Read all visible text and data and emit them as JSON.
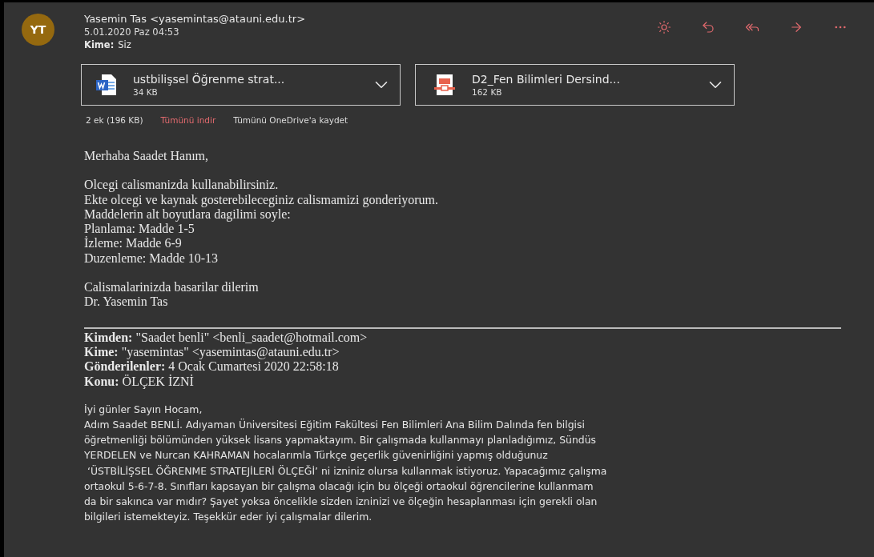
{
  "sender": {
    "initials": "YT",
    "name": "Yasemin Tas <yasemintas@atauni.edu.tr>",
    "date": "5.01.2020 Paz 04:53",
    "to_label": "Kime:",
    "to": "Siz"
  },
  "actions": [
    {
      "kind": "sun"
    },
    {
      "kind": "reply"
    },
    {
      "kind": "reply-all"
    },
    {
      "kind": "forward"
    },
    {
      "kind": "more"
    }
  ],
  "attachments": [
    {
      "kind": "word",
      "name": "ustbilişsel Öğrenme strat...",
      "size": "34 KB"
    },
    {
      "kind": "pdf",
      "name": "D2_Fen Bilimleri Dersind...",
      "size": "162 KB"
    }
  ],
  "attachment_bar": {
    "summary": "2 ek (196 KB)",
    "download_all": "Tümünü indir",
    "save_onedrive": "Tümünü OneDrive'a kaydet"
  },
  "reply_paragraphs": [
    [
      "Merhaba Saadet Hanım,"
    ],
    [
      "Olcegi calismanizda kullanabilirsiniz.",
      "Ekte olcegi ve kaynak gosterebileceginiz calismamizi gonderiyorum.",
      "Maddelerin alt boyutlara dagilimi soyle:",
      "Planlama: Madde 1-5",
      "İzleme: Madde 6-9",
      "Duzenleme: Madde 10-13"
    ],
    [
      "Calismalarinizda basarilar dilerim",
      "Dr. Yasemin Tas"
    ]
  ],
  "quoted_header": [
    "**Kimden:** \"Saadet benli\" <benli_saadet@hotmail.com>",
    "**Kime:** \"yasemintas\" <yasemintas@atauni.edu.tr>",
    "**Gönderilenler:** 4 Ocak Cumartesi 2020 22:58:18",
    "**Konu:** ÖLÇEK İZNİ"
  ],
  "quoted_body": [
    "İyi günler Sayın Hocam,",
    "Adım Saadet BENLİ. Adıyaman Üniversitesi Eğitim Fakültesi Fen Bilimleri Ana Bilim Dalında fen bilgisi",
    "öğretmenliği bölümünden yüksek lisans yapmaktayım. Bir çalışmada kullanmayı planladığımız, Sündüs",
    "YERDELEN ve Nurcan KAHRAMAN hocalarımla Türkçe geçerlik güvenirliğini yapmış olduğunuz",
    " ‘ÜSTBİLİŞSEL ÖĞRENME STRATEJİLERİ ÖLÇEĞİ’ ni izniniz olursa kullanmak istiyoruz. Yapacağımız çalışma",
    "ortaokul 5-6-7-8. Sınıfları kapsayan bir çalışma olacağı için bu ölçeği ortaokul öğrencilerine kullanmam",
    "da bir sakınca var mıdır? Şayet yoksa öncelikle sizden izninizi ve ölçeğin hesaplanması için gerekli olan",
    "bilgileri istemekteyiz. Teşekkür eder iyi çalışmalar dilerim."
  ]
}
